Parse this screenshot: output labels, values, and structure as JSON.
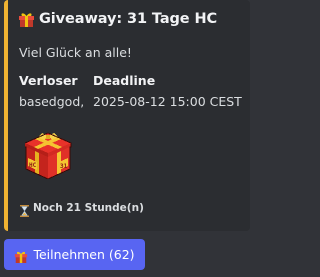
{
  "embed": {
    "accent_color": "#f0b232",
    "title_icon": "gift-icon",
    "title": "Giveaway: 31 Tage HC",
    "description": "Viel Glück an alle!",
    "fields": [
      {
        "name": "Verloser",
        "value": "basedgod,"
      },
      {
        "name": "Deadline",
        "value": "2025-08-12 15:00 CEST"
      }
    ],
    "image": "red-gift-box-hc-31",
    "footer_icon": "hourglass-icon",
    "footer_text": "Noch 21 Stunde(n)"
  },
  "button": {
    "icon": "gift-icon",
    "label": "Teilnehmen (62)",
    "color": "#5865f2"
  }
}
